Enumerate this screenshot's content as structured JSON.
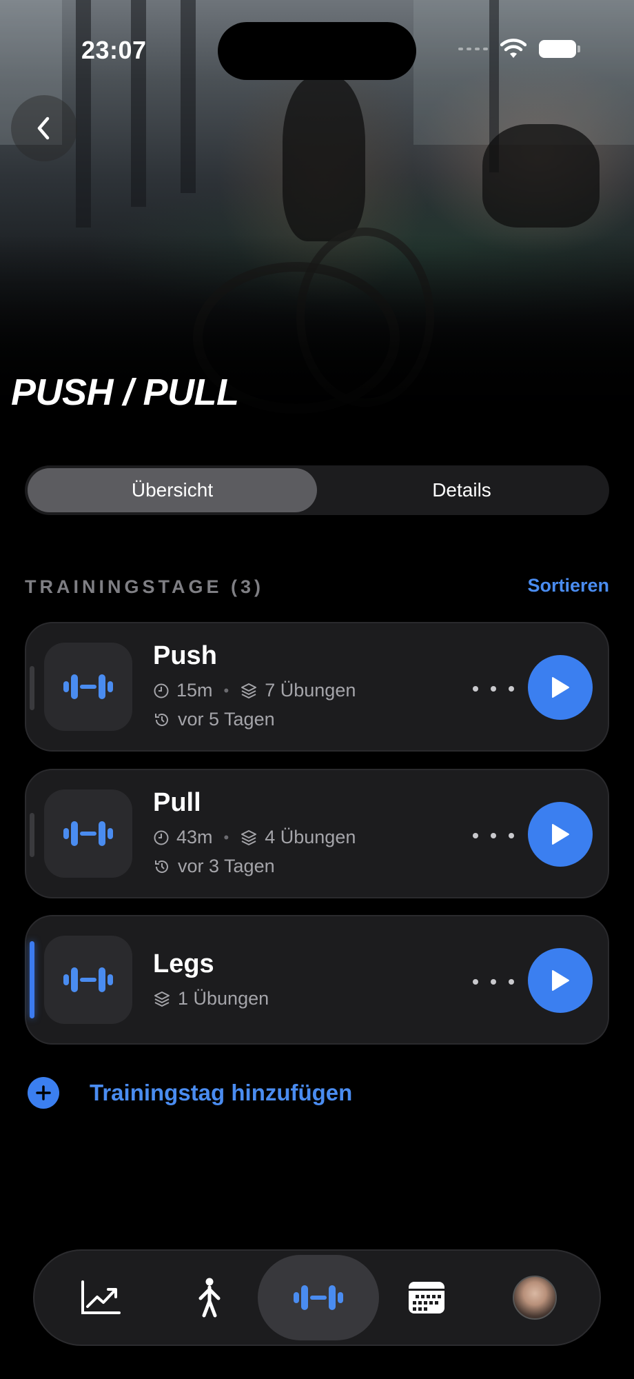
{
  "status_bar": {
    "time": "23:07"
  },
  "header": {
    "title": "PUSH / PULL"
  },
  "segmented": {
    "tabs": [
      "Übersicht",
      "Details"
    ],
    "selected": "Übersicht"
  },
  "section": {
    "title": "TRAININGSTAGE (3)",
    "sort_label": "Sortieren"
  },
  "training_days": [
    {
      "name": "Push",
      "duration": "15m",
      "exercises": "7 Übungen",
      "last": "vor 5 Tagen"
    },
    {
      "name": "Pull",
      "duration": "43m",
      "exercises": "4 Übungen",
      "last": "vor 3 Tagen"
    },
    {
      "name": "Legs",
      "exercises": "1 Übungen"
    }
  ],
  "add_label": "Trainingstag hinzufügen",
  "tabbar": {
    "items": [
      "chart-icon",
      "figure-icon",
      "dumbbell-icon",
      "calendar-icon",
      "avatar"
    ],
    "selected": "dumbbell-icon"
  },
  "colors": {
    "accent": "#3b7ff0",
    "link": "#4a8cf0",
    "card": "#1c1c1e",
    "background": "#000000"
  }
}
